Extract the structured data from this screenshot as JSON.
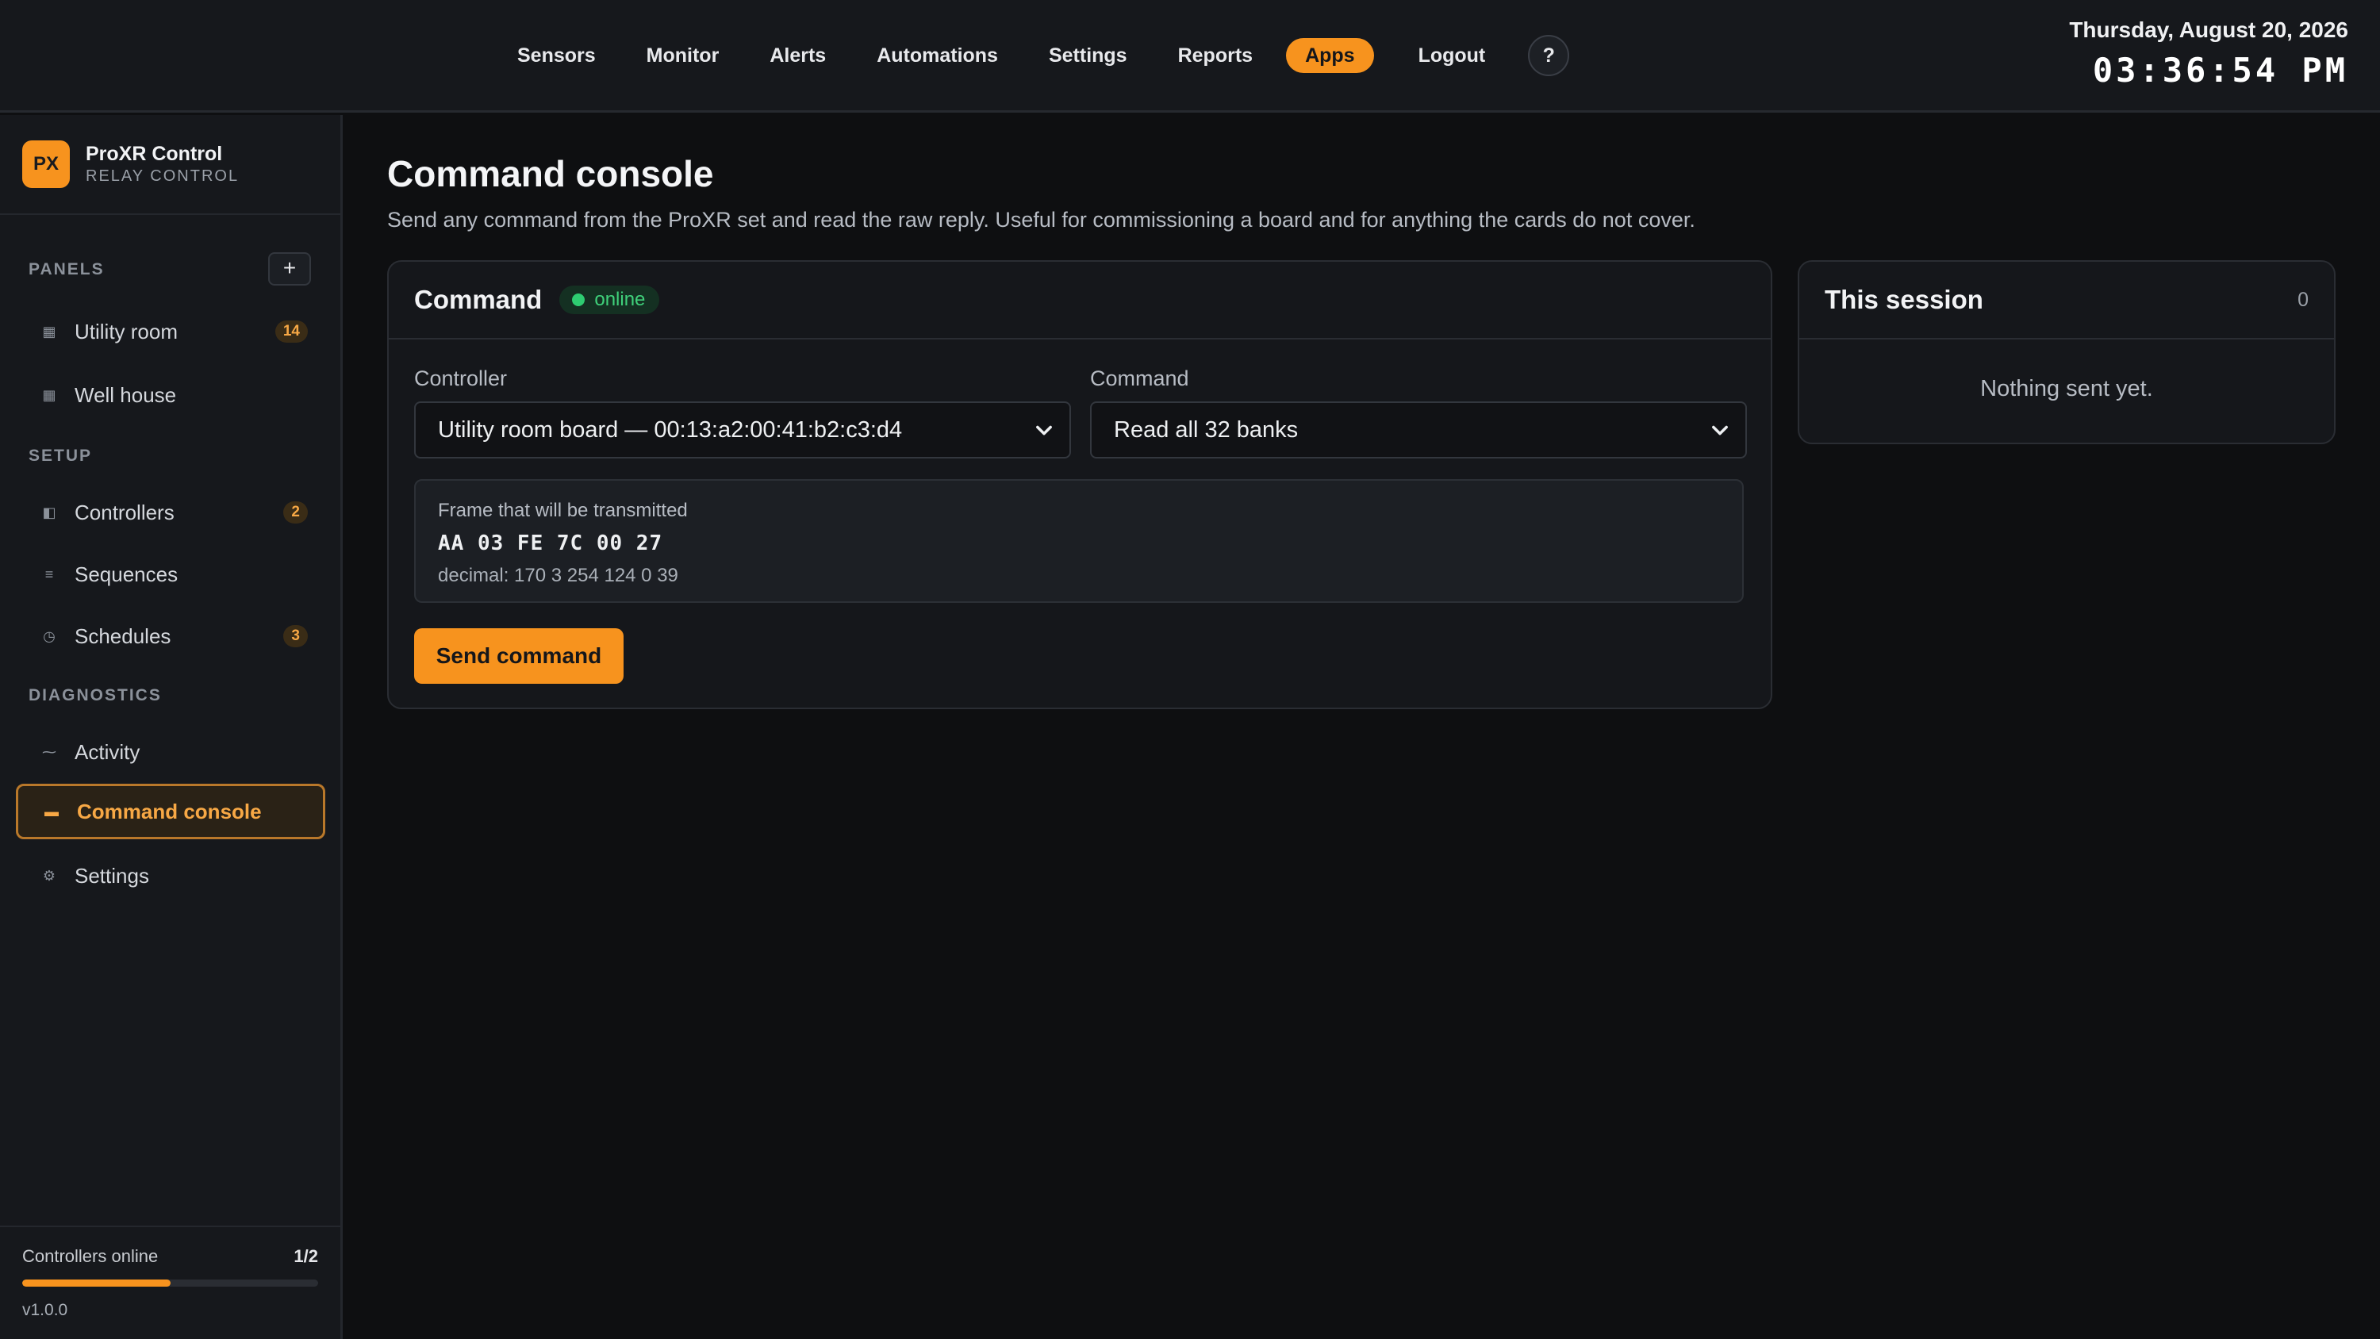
{
  "nav": {
    "items": [
      "Sensors",
      "Monitor",
      "Alerts",
      "Automations",
      "Settings",
      "Reports",
      "Apps",
      "Logout"
    ],
    "active": "Apps",
    "help_label": "?"
  },
  "clock": {
    "date": "Thursday, August 20, 2026",
    "time": "03:36:54 PM"
  },
  "brand": {
    "logo": "PX",
    "name": "ProXR Control",
    "subtitle": "RELAY CONTROL"
  },
  "sidebar": {
    "panels_label": "PANELS",
    "add_label": "+",
    "panels": [
      {
        "label": "Utility room",
        "badge": "14",
        "icon": "grid-icon"
      },
      {
        "label": "Well house",
        "badge": null,
        "icon": "grid-icon"
      }
    ],
    "setup_label": "SETUP",
    "setup": [
      {
        "label": "Controllers",
        "badge": "2",
        "icon": "controller-icon"
      },
      {
        "label": "Sequences",
        "badge": null,
        "icon": "list-icon"
      },
      {
        "label": "Schedules",
        "badge": "3",
        "icon": "clock-icon"
      }
    ],
    "diagnostics_label": "DIAGNOSTICS",
    "diagnostics": [
      {
        "label": "Activity",
        "badge": null,
        "icon": "activity-icon"
      },
      {
        "label": "Command console",
        "badge": null,
        "icon": "console-icon",
        "active": true
      },
      {
        "label": "Settings",
        "badge": null,
        "icon": "gear-icon"
      }
    ],
    "footer": {
      "controllers_label": "Controllers online",
      "controllers_value": "1/2",
      "progress_fraction": 0.5,
      "version": "v1.0.0"
    }
  },
  "page": {
    "title": "Command console",
    "description": "Send any command from the ProXR set and read the raw reply. Useful for commissioning a board and for anything the cards do not cover."
  },
  "command_card": {
    "title": "Command",
    "status": "online",
    "controller_label": "Controller",
    "controller_value": "Utility room board — 00:13:a2:00:41:b2:c3:d4",
    "command_label": "Command",
    "command_value": "Read all 32 banks",
    "frame_label": "Frame that will be transmitted",
    "frame_hex": "AA 03 FE 7C 00 27",
    "frame_decimal": "decimal: 170 3 254 124 0 39",
    "send_label": "Send command"
  },
  "session_card": {
    "title": "This session",
    "count": "0",
    "empty_text": "Nothing sent yet."
  },
  "colors": {
    "accent": "#f7931e",
    "background": "#0e0f11",
    "panel": "#16181c",
    "online": "#2ecc71"
  }
}
